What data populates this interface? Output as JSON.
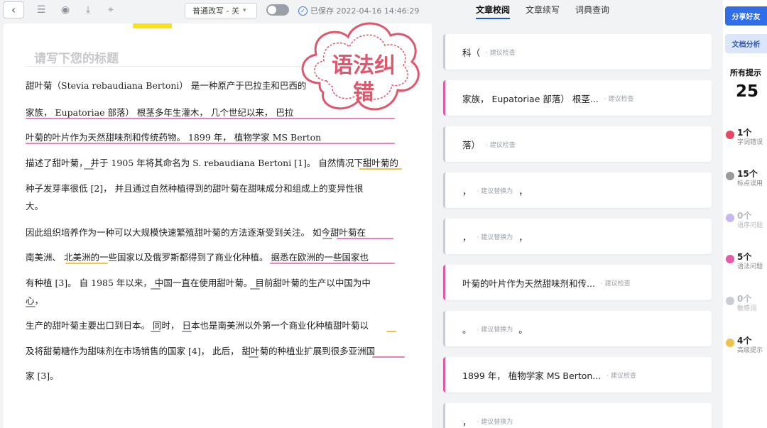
{
  "toolbar": {
    "mode": "普通改写 - 关",
    "saved": "已保存 2022-04-16 14:46:29"
  },
  "tabs": [
    "文章校阅",
    "文章续写",
    "词典查询"
  ],
  "editor": {
    "title_placeholder": "请写下您的标题",
    "lines": [
      "甜叶菊（Stevia rebaudiana Bertoni） 是一种原产于巴拉圭和巴西的",
      "家族， Eupatoriae 部落） 根茎多年生灌木， 几个世纪以来， 巴拉",
      "叶菊的叶片作为天然甜味剂和传统药物。 1899 年， 植物学家 MS Berton",
      "描述了甜叶菊， 并于 1905 年将其命名为 S. rebaudiana Bertoni [1]。 自然情况下甜叶菊的",
      "种子发芽率很低 [2]， 并且通过自然种植得到的甜叶菊在甜味成分和组成上的变异性很",
      "大。",
      "因此组织培养作为一种可以大规模快速繁殖甜叶菊的方法逐渐受到关注。 如今甜叶菊在",
      "南美洲、 北美洲的一些国家以及俄罗斯都得到了商业化种植。 据悉在欧洲的一些国家也",
      "有种植 [3]。 自 1985 年以来， 中国一直在使用甜叶菊。 目前甜叶菊的生产以中国为中",
      "心，",
      "生产的甜叶菊主要出口到日本。 同时， 日本也是南美洲以外第一个商业化种植甜叶菊以",
      "及将甜菊糖作为甜味剂在市场销售的国家 [4]， 此后， 甜叶菊的种植业扩展到很多亚洲国",
      "家 [3]。"
    ]
  },
  "stamp": {
    "line1": "语法纠",
    "line2": "错"
  },
  "suggestions": [
    {
      "text": "科（",
      "hint": "· 建议检查",
      "after": ""
    },
    {
      "text": "家族， Eupatoriae 部落） 根茎...",
      "hint": "· 建议检查",
      "after": ""
    },
    {
      "text": "落）",
      "hint": "· 建议检查",
      "after": ""
    },
    {
      "text": "，",
      "hint": "· 建议替换为",
      "after": "，"
    },
    {
      "text": "，",
      "hint": "· 建议替换为",
      "after": "，"
    },
    {
      "text": "叶菊的叶片作为天然甜味剂和传...",
      "hint": "· 建议检查",
      "after": ""
    },
    {
      "text": "。",
      "hint": "· 建议替换为",
      "after": "。"
    },
    {
      "text": "1899 年， 植物学家 MS Berton...",
      "hint": "· 建议检查",
      "after": ""
    },
    {
      "text": "，",
      "hint": "· 建议替换为",
      "after": ""
    }
  ],
  "sidebar": {
    "share": "分享好友",
    "analysis": "文档分析",
    "all_label": "所有提示",
    "all_count": "25",
    "stats": [
      {
        "num": "1个",
        "label": "字词错误",
        "color": "#e8475f"
      },
      {
        "num": "15个",
        "label": "标点误用",
        "color": "#9a9a9a"
      },
      {
        "num": "0个",
        "label": "语序问题",
        "color": "#c9b6f2"
      },
      {
        "num": "5个",
        "label": "语法问题",
        "color": "#e85aa8"
      },
      {
        "num": "0个",
        "label": "敏感词",
        "color": "#c9ccd2"
      },
      {
        "num": "4个",
        "label": "高级提示",
        "color": "#efc24a"
      }
    ]
  }
}
